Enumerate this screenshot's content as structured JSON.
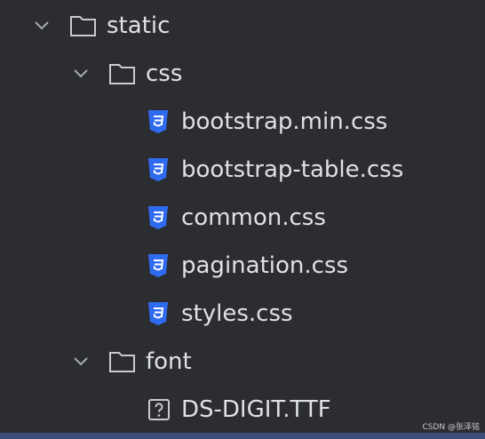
{
  "tree": {
    "static": {
      "label": "static"
    },
    "css": {
      "label": "css",
      "files": [
        {
          "name": "bootstrap.min.css"
        },
        {
          "name": "bootstrap-table.css"
        },
        {
          "name": "common.css"
        },
        {
          "name": "pagination.css"
        },
        {
          "name": "styles.css"
        }
      ]
    },
    "font": {
      "label": "font",
      "files": [
        {
          "name": "DS-DIGIT.TTF"
        }
      ]
    }
  },
  "watermark": "CSDN @张泽铭",
  "colors": {
    "background": "#2b2d30",
    "text": "#dfe1e5",
    "css_icon": "#2f6bf0",
    "selection_bar": "#3d4f78"
  }
}
